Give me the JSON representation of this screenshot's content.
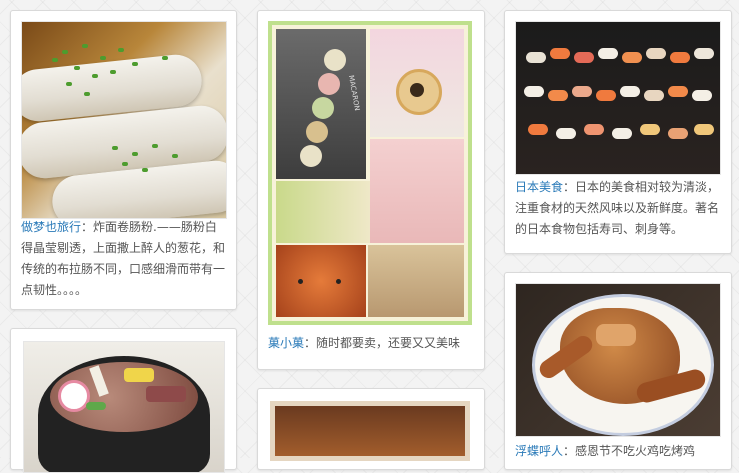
{
  "cards": [
    {
      "author": "做梦也旅行",
      "sep": "：",
      "text": "炸面卷肠粉.——肠粉白得晶莹剔透，上面撒上醉人的葱花，和传统的布拉肠不同，口感细滑而带有一点韧性。。。。"
    },
    {
      "author": "菓小菓",
      "sep": "：",
      "text": "随时都要卖，还要又又美味",
      "macaron_box_label": "MACARON"
    },
    {
      "author": "日本美食",
      "sep": "：",
      "text": "日本的美食相对较为清淡，注重食材的天然风味以及新鲜度。著名的日本食物包括寿司、刺身等。"
    },
    {
      "author": "浮蝶呼人",
      "sep": "：",
      "text": "感恩节不吃火鸡吃烤鸡"
    }
  ],
  "colors": {
    "author_link": "#2a7ab8",
    "caption_text": "#555555",
    "collage_border": "#bfe08d"
  }
}
